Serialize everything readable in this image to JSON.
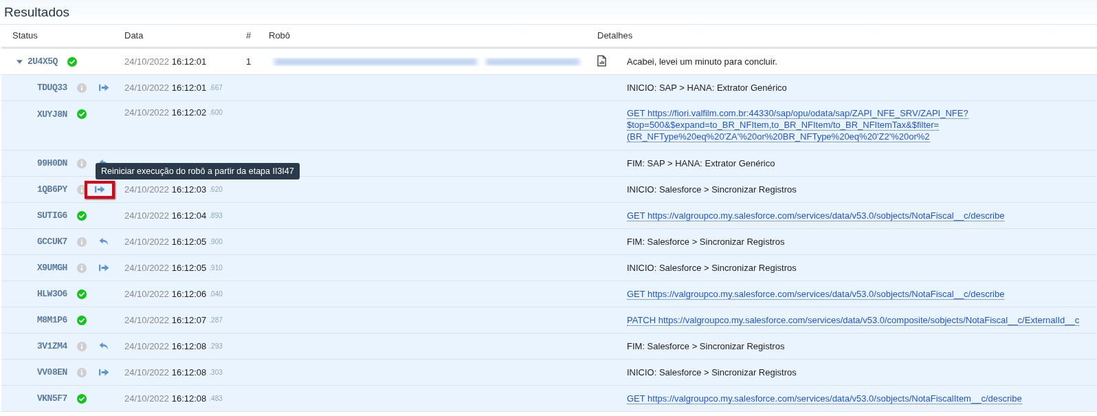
{
  "title": "Resultados",
  "columns": [
    "Status",
    "Data",
    "#",
    "Robô",
    "Detalhes"
  ],
  "rows": [
    {
      "id": "2U4X5Q",
      "expanded": true,
      "succeeded": true,
      "date": "24/10/2022",
      "time": "16:12:01",
      "number": "1",
      "robot_blurred": true,
      "report": true,
      "kind": "text",
      "details": [
        "Acabei, levei um minuto para concluir."
      ]
    },
    {
      "id": "TDUQ33",
      "succeeded": false,
      "action": {
        "kind": "next"
      },
      "date": "24/10/2022",
      "time": "16:12:01",
      "ms": ".667",
      "kind": "text",
      "details": [
        "INICIO: SAP > HANA: Extrator Genérico"
      ]
    },
    {
      "id": "XUYJ8N",
      "succeeded": true,
      "date": "24/10/2022",
      "time": "16:12:02",
      "ms": ".600",
      "kind": "link",
      "details": [
        "GET https://fiori.valfilm.com.br:44330/sap/opu/odata/sap/ZAPI_NFE_SRV/ZAPI_NFE?",
        "$top=500&$expand=to_BR_NFItem,to_BR_NFItem/to_BR_NFItemTax&$filter=",
        "(BR_NFType%20eq%20'ZA'%20or%20BR_NFType%20eq%20'Z2'%20or%2"
      ]
    },
    {
      "id": "99H0DN",
      "succeeded": false,
      "action": {
        "kind": "undo"
      },
      "kind": "text",
      "details": [
        "FIM: SAP > HANA: Extrator Genérico"
      ]
    },
    {
      "id": "1QB6PY",
      "succeeded": false,
      "action": {
        "kind": "next"
      },
      "highlighted": true,
      "date": "24/10/2022",
      "time": "16:12:03",
      "ms": ".620",
      "kind": "text",
      "details": [
        "INICIO: Salesforce > Sincronizar Registros"
      ]
    },
    {
      "id": "SUTIG6",
      "succeeded": true,
      "date": "24/10/2022",
      "time": "16:12:04",
      "ms": ".893",
      "kind": "link",
      "details": [
        "GET https://valgroupco.my.salesforce.com/services/data/v53.0/sobjects/NotaFiscal__c/describe"
      ]
    },
    {
      "id": "GCCUK7",
      "succeeded": false,
      "action": {
        "kind": "undo"
      },
      "date": "24/10/2022",
      "time": "16:12:05",
      "ms": ".900",
      "kind": "text",
      "details": [
        "FIM: Salesforce > Sincronizar Registros"
      ]
    },
    {
      "id": "X9UMGH",
      "succeeded": false,
      "action": {
        "kind": "next"
      },
      "date": "24/10/2022",
      "time": "16:12:05",
      "ms": ".910",
      "kind": "text",
      "details": [
        "INICIO: Salesforce > Sincronizar Registros"
      ]
    },
    {
      "id": "HLW3O6",
      "succeeded": true,
      "date": "24/10/2022",
      "time": "16:12:06",
      "ms": ".040",
      "kind": "link",
      "details": [
        "GET https://valgroupco.my.salesforce.com/services/data/v53.0/sobjects/NotaFiscal__c/describe"
      ]
    },
    {
      "id": "M8M1P6",
      "succeeded": true,
      "date": "24/10/2022",
      "time": "16:12:07",
      "ms": ".287",
      "kind": "link",
      "details": [
        "PATCH https://valgroupco.my.salesforce.com/services/data/v53.0/composite/sobjects/NotaFiscal__c/ExternalId__c"
      ]
    },
    {
      "id": "3V1ZM4",
      "succeeded": false,
      "action": {
        "kind": "undo"
      },
      "date": "24/10/2022",
      "time": "16:12:08",
      "ms": ".293",
      "kind": "text",
      "details": [
        "FIM: Salesforce > Sincronizar Registros"
      ]
    },
    {
      "id": "VV08EN",
      "succeeded": false,
      "action": {
        "kind": "next"
      },
      "date": "24/10/2022",
      "time": "16:12:08",
      "ms": ".303",
      "kind": "text",
      "details": [
        "INICIO: Salesforce > Sincronizar Registros"
      ]
    },
    {
      "id": "VKN5F7",
      "succeeded": true,
      "date": "24/10/2022",
      "time": "16:12:08",
      "ms": ".483",
      "kind": "link",
      "details": [
        "GET https://valgroupco.my.salesforce.com/services/data/v53.0/sobjects/NotaFiscalItem__c/describe"
      ]
    }
  ],
  "tooltip": "Reiniciar execução do robô a partir da etapa II3I47"
}
